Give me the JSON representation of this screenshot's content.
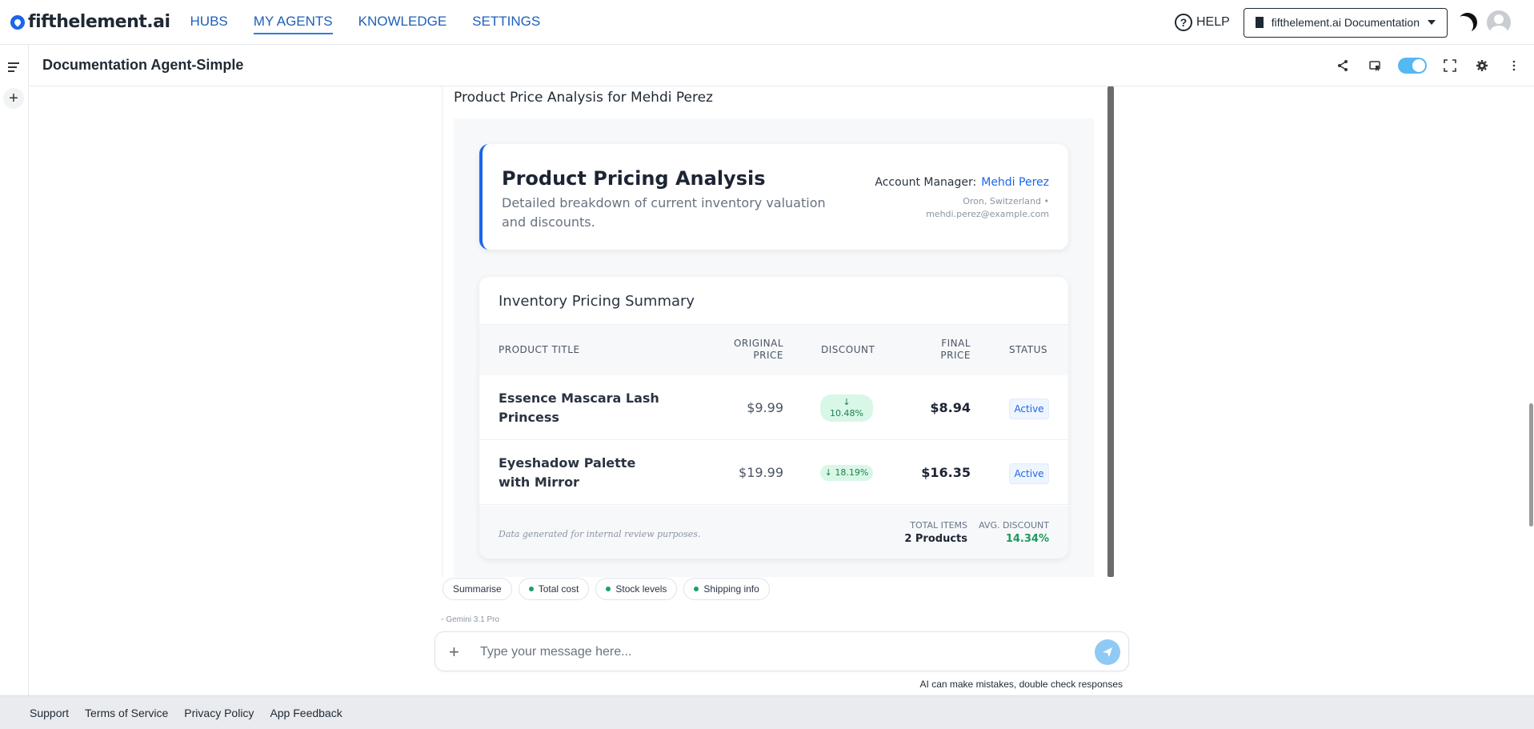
{
  "brand": {
    "name": "fifthelement.ai"
  },
  "nav": [
    {
      "label": "HUBS",
      "active": false
    },
    {
      "label": "MY AGENTS",
      "active": true
    },
    {
      "label": "KNOWLEDGE",
      "active": false
    },
    {
      "label": "SETTINGS",
      "active": false
    }
  ],
  "topright": {
    "help_label": "HELP",
    "org_label": "fifthelement.ai Documentation"
  },
  "agent": {
    "title": "Documentation Agent-Simple"
  },
  "message": {
    "heading": "Product Price Analysis for Mehdi Perez",
    "hero": {
      "title": "Product Pricing Analysis",
      "description": "Detailed breakdown of current inventory valuation and discounts.",
      "manager_label": "Account Manager:",
      "manager_name": "Mehdi Perez",
      "location": "Oron, Switzerland •",
      "email": "mehdi.perez@example.com"
    },
    "table": {
      "title": "Inventory Pricing Summary",
      "headers": {
        "product": "PRODUCT TITLE",
        "original_1": "ORIGINAL",
        "original_2": "PRICE",
        "discount": "DISCOUNT",
        "final_1": "FINAL",
        "final_2": "PRICE",
        "status": "STATUS"
      },
      "rows": [
        {
          "product": "Essence Mascara Lash Princess",
          "original": "$9.99",
          "discount_arrow": "↓",
          "discount": "10.48%",
          "final": "$8.94",
          "status": "Active"
        },
        {
          "product": "Eyeshadow Palette with Mirror",
          "original": "$19.99",
          "discount": "↓ 18.19%",
          "final": "$16.35",
          "status": "Active"
        }
      ],
      "footer": {
        "note": "Data generated for internal review purposes.",
        "total_label": "TOTAL ITEMS",
        "total_value": "2 Products",
        "avg_label": "AVG. DISCOUNT",
        "avg_value": "14.34%"
      }
    }
  },
  "suggestions": [
    {
      "label": "Summarise",
      "dot": false
    },
    {
      "label": "Total cost",
      "dot": true
    },
    {
      "label": "Stock levels",
      "dot": true
    },
    {
      "label": "Shipping info",
      "dot": true
    }
  ],
  "model": {
    "label": "Gemini 3.1 Pro"
  },
  "composer": {
    "placeholder": "Type your message here..."
  },
  "disclaimer": "AI can make mistakes, double check responses",
  "footer_links": [
    "Support",
    "Terms of Service",
    "Privacy Policy",
    "App Feedback"
  ],
  "colors": {
    "accent": "#1a66e8",
    "positive": "#1d7f4e",
    "footer_bg": "#e9ebef"
  }
}
